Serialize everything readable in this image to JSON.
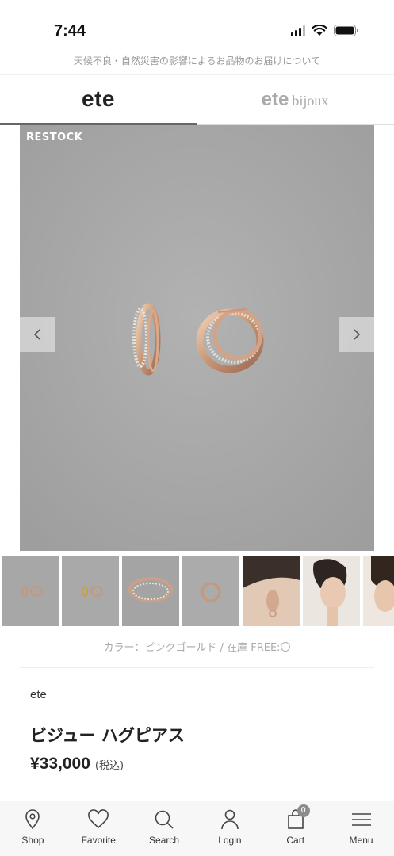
{
  "status_bar": {
    "time": "7:44"
  },
  "notice": {
    "text": "天候不良・自然災害の影響によるお品物のお届けについて"
  },
  "brand_tabs": [
    {
      "name": "ete",
      "active": true
    },
    {
      "name_main": "ete",
      "name_sub": "bijoux",
      "active": false
    }
  ],
  "main_image": {
    "badge": "RESTOCK"
  },
  "thumbnails": [
    "earrings-pair",
    "earrings-pair-front",
    "earring-closeup",
    "earring-side",
    "model-ear",
    "model-profile",
    "model-partial"
  ],
  "product": {
    "color_stock": "カラー：ピンクゴールド / 在庫 FREE:〇",
    "brand": "ete",
    "title": "ビジュー ハグピアス",
    "price": "¥33,000",
    "tax": "(税込)"
  },
  "bottom_nav": {
    "items": [
      {
        "label": "Shop",
        "icon": "location-pin-icon"
      },
      {
        "label": "Favorite",
        "icon": "heart-icon"
      },
      {
        "label": "Search",
        "icon": "search-icon"
      },
      {
        "label": "Login",
        "icon": "person-icon"
      },
      {
        "label": "Cart",
        "icon": "shopping-bag-icon",
        "count": "0"
      },
      {
        "label": "Menu",
        "icon": "hamburger-menu-icon"
      }
    ]
  }
}
